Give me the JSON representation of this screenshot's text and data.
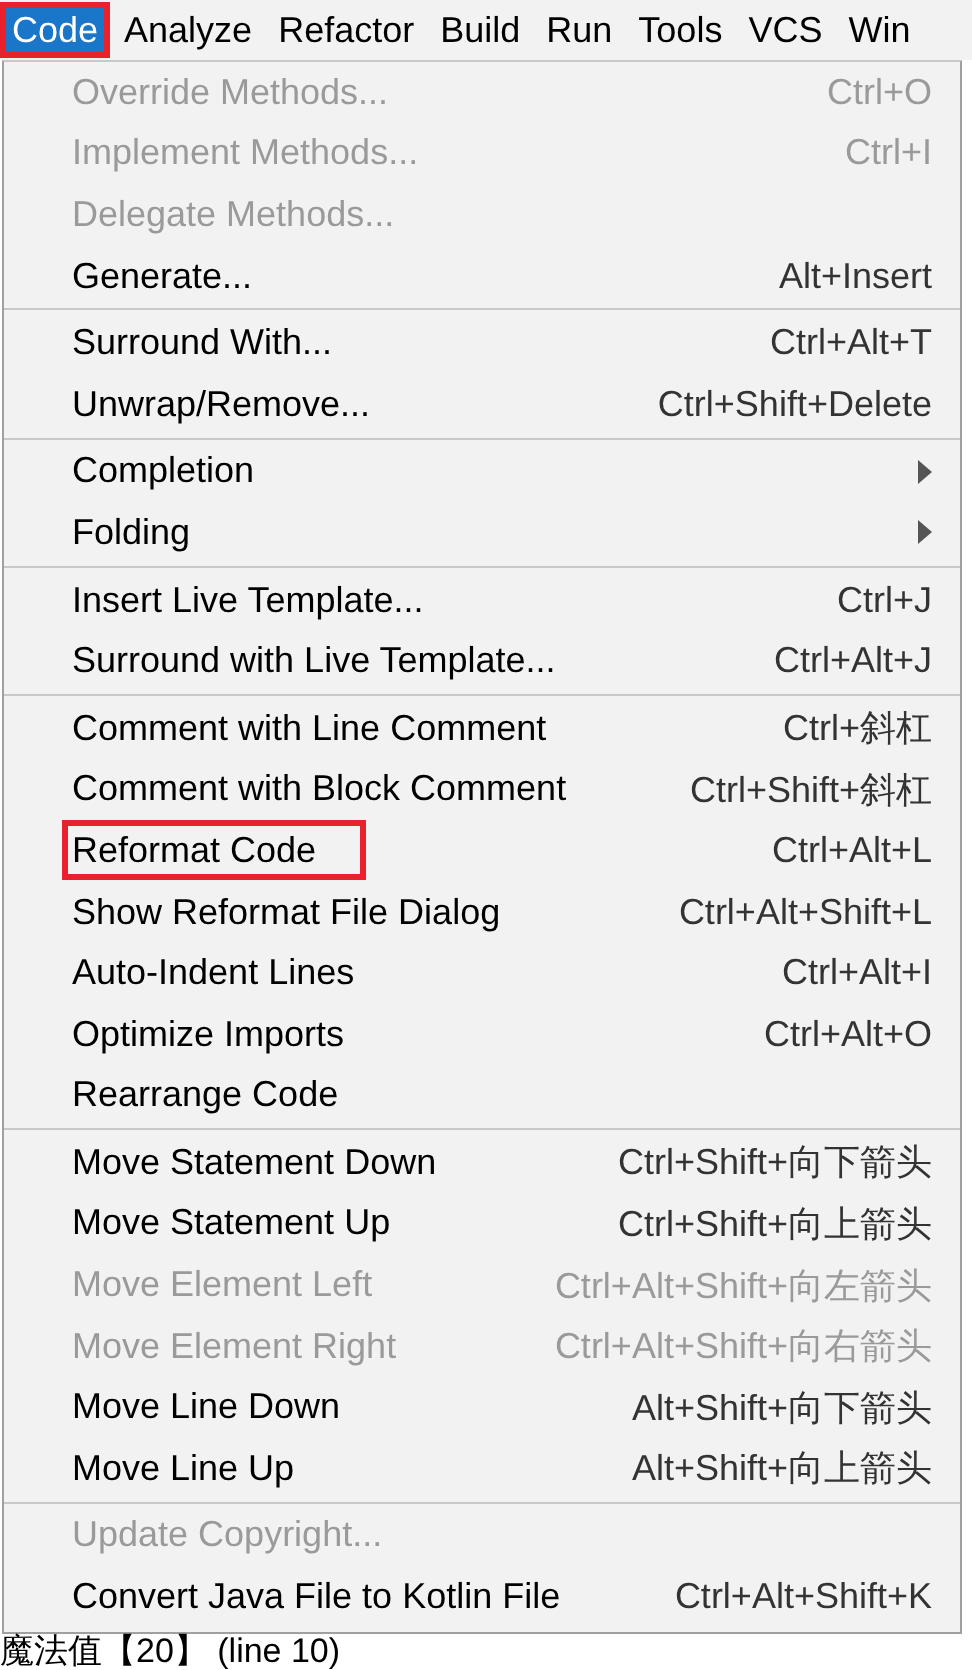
{
  "menu_bar": [
    {
      "label": "Code",
      "selected": true,
      "highlighted": true
    },
    {
      "label": "Analyze",
      "selected": false,
      "highlighted": false
    },
    {
      "label": "Refactor",
      "selected": false,
      "highlighted": false
    },
    {
      "label": "Build",
      "selected": false,
      "highlighted": false
    },
    {
      "label": "Run",
      "selected": false,
      "highlighted": false
    },
    {
      "label": "Tools",
      "selected": false,
      "highlighted": false
    },
    {
      "label": "VCS",
      "selected": false,
      "highlighted": false
    },
    {
      "label": "Win",
      "selected": false,
      "highlighted": false
    }
  ],
  "menu": {
    "items": [
      {
        "kind": "item",
        "label": "Override Methods...",
        "shortcut": "Ctrl+O",
        "disabled": true,
        "highlighted": false
      },
      {
        "kind": "item",
        "label": "Implement Methods...",
        "shortcut": "Ctrl+I",
        "disabled": true,
        "highlighted": false
      },
      {
        "kind": "item",
        "label": "Delegate Methods...",
        "disabled": true,
        "highlighted": false
      },
      {
        "kind": "item",
        "label": "Generate...",
        "shortcut": "Alt+Insert",
        "disabled": false,
        "highlighted": false
      },
      {
        "kind": "separator"
      },
      {
        "kind": "item",
        "label": "Surround With...",
        "shortcut": "Ctrl+Alt+T",
        "disabled": false,
        "highlighted": false
      },
      {
        "kind": "item",
        "label": "Unwrap/Remove...",
        "shortcut": "Ctrl+Shift+Delete",
        "disabled": false,
        "highlighted": false
      },
      {
        "kind": "separator"
      },
      {
        "kind": "submenu",
        "label": "Completion",
        "disabled": false,
        "highlighted": false
      },
      {
        "kind": "submenu",
        "label": "Folding",
        "disabled": false,
        "highlighted": false
      },
      {
        "kind": "separator"
      },
      {
        "kind": "item",
        "label": "Insert Live Template...",
        "shortcut": "Ctrl+J",
        "disabled": false,
        "highlighted": false
      },
      {
        "kind": "item",
        "label": "Surround with Live Template...",
        "shortcut": "Ctrl+Alt+J",
        "disabled": false,
        "highlighted": false
      },
      {
        "kind": "separator"
      },
      {
        "kind": "item",
        "label": "Comment with Line Comment",
        "shortcut": "Ctrl+斜杠",
        "disabled": false,
        "highlighted": false
      },
      {
        "kind": "item",
        "label": "Comment with Block Comment",
        "shortcut": "Ctrl+Shift+斜杠",
        "disabled": false,
        "highlighted": false
      },
      {
        "kind": "item",
        "label": "Reformat Code",
        "shortcut": "Ctrl+Alt+L",
        "disabled": false,
        "highlighted": true
      },
      {
        "kind": "item",
        "label": "Show Reformat File Dialog",
        "shortcut": "Ctrl+Alt+Shift+L",
        "disabled": false,
        "highlighted": false
      },
      {
        "kind": "item",
        "label": "Auto-Indent Lines",
        "shortcut": "Ctrl+Alt+I",
        "disabled": false,
        "highlighted": false
      },
      {
        "kind": "item",
        "label": "Optimize Imports",
        "shortcut": "Ctrl+Alt+O",
        "disabled": false,
        "highlighted": false
      },
      {
        "kind": "item",
        "label": "Rearrange Code",
        "disabled": false,
        "highlighted": false
      },
      {
        "kind": "separator"
      },
      {
        "kind": "item",
        "label": "Move Statement Down",
        "shortcut": "Ctrl+Shift+向下箭头",
        "disabled": false,
        "highlighted": false
      },
      {
        "kind": "item",
        "label": "Move Statement Up",
        "shortcut": "Ctrl+Shift+向上箭头",
        "disabled": false,
        "highlighted": false
      },
      {
        "kind": "item",
        "label": "Move Element Left",
        "shortcut": "Ctrl+Alt+Shift+向左箭头",
        "disabled": true,
        "highlighted": false
      },
      {
        "kind": "item",
        "label": "Move Element Right",
        "shortcut": "Ctrl+Alt+Shift+向右箭头",
        "disabled": true,
        "highlighted": false
      },
      {
        "kind": "item",
        "label": "Move Line Down",
        "shortcut": "Alt+Shift+向下箭头",
        "disabled": false,
        "highlighted": false
      },
      {
        "kind": "item",
        "label": "Move Line Up",
        "shortcut": "Alt+Shift+向上箭头",
        "disabled": false,
        "highlighted": false
      },
      {
        "kind": "separator"
      },
      {
        "kind": "item",
        "label": "Update Copyright...",
        "disabled": true,
        "highlighted": false
      },
      {
        "kind": "item",
        "label": "Convert Java File to Kotlin File",
        "shortcut": "Ctrl+Alt+Shift+K",
        "disabled": false,
        "highlighted": false
      }
    ]
  },
  "editor_text": "魔法值【20】 (line 10)"
}
